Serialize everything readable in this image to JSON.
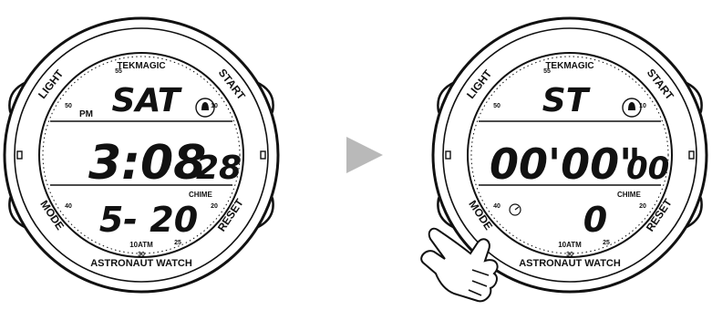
{
  "diagram": {
    "arrow_color": "#b9b9b9",
    "ink_color": "#111111"
  },
  "watches": [
    {
      "brand": "TEKMAGIC",
      "model": "ASTRONAUT WATCH",
      "depth_rating": "10ATM",
      "bezel_labels": {
        "light": "LIGHT",
        "start": "START",
        "mode": "MODE",
        "reset": "RESET"
      },
      "dial_numbers": {
        "n55": "55",
        "n50": "50",
        "n10": "10",
        "n40": "40",
        "n20": "20",
        "n25": "25",
        "n30": "30"
      },
      "display": {
        "top": "SAT",
        "ampm": "PM",
        "main": "3:08",
        "main_small": "28",
        "bottom": "5- 20",
        "chime": "CHIME"
      }
    },
    {
      "brand": "TEKMAGIC",
      "model": "ASTRONAUT WATCH",
      "depth_rating": "10ATM",
      "bezel_labels": {
        "light": "LIGHT",
        "start": "START",
        "mode": "MODE",
        "reset": "RESET"
      },
      "dial_numbers": {
        "n55": "55",
        "n50": "50",
        "n10": "10",
        "n40": "40",
        "n20": "20",
        "n25": "25",
        "n30": "30"
      },
      "display": {
        "top": "ST",
        "main": "00'00\"",
        "main_small": "00",
        "bottom": "0",
        "chime": "CHIME"
      }
    }
  ]
}
